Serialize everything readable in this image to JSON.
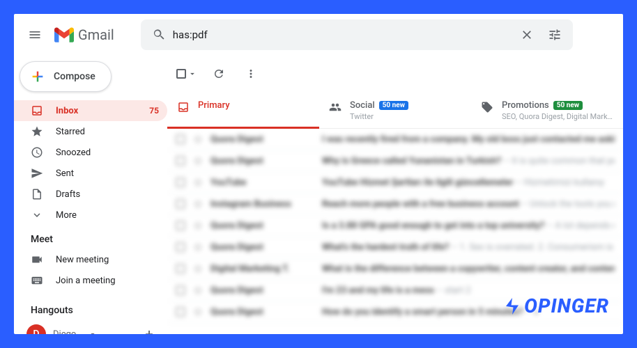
{
  "header": {
    "app_name": "Gmail",
    "search_value": "has:pdf"
  },
  "sidebar": {
    "compose": "Compose",
    "items": [
      {
        "icon": "inbox",
        "label": "Inbox",
        "count": "75",
        "active": true
      },
      {
        "icon": "star",
        "label": "Starred"
      },
      {
        "icon": "clock",
        "label": "Snoozed"
      },
      {
        "icon": "send",
        "label": "Sent"
      },
      {
        "icon": "file",
        "label": "Drafts"
      },
      {
        "icon": "more",
        "label": "More"
      }
    ],
    "meet_title": "Meet",
    "meet_items": [
      {
        "icon": "video",
        "label": "New meeting"
      },
      {
        "icon": "keyboard",
        "label": "Join a meeting"
      }
    ],
    "hangouts_title": "Hangouts",
    "hangouts_user_initial": "D",
    "hangouts_user_name": "Diego"
  },
  "tabs": [
    {
      "icon": "inbox",
      "title": "Primary",
      "active": true
    },
    {
      "icon": "people",
      "title": "Social",
      "badge": "50 new",
      "sub": "Twitter"
    },
    {
      "icon": "tag",
      "title": "Promotions",
      "badge": "50 new",
      "badge_class": "green",
      "sub": "SEO, Quora Digest, Digital Mark..."
    }
  ],
  "threads": [
    {
      "sender": "Quora Digest",
      "subject": "I was recently fired from a company. My old boss just contacted me aski",
      "snippet": ""
    },
    {
      "sender": "Quora Digest",
      "subject": "Why is Greece called Yunanistan in Turkish?",
      "snippet": " – It is quite common that peo"
    },
    {
      "sender": "YouTube",
      "subject": "YouTube Hizmet Şartları ile ilgili güncellemeler",
      "snippet": " – Hizmetimizi kullanıy"
    },
    {
      "sender": "Instagram Business",
      "subject": "Reach more people with a free business account",
      "snippet": " – Unlock the tools you ne"
    },
    {
      "sender": "Quora Digest",
      "subject": "Is a 3.88 GPA good enough to get into a top university?",
      "snippet": " – A lot depends on"
    },
    {
      "sender": "Quora Digest",
      "subject": "What's the hardest truth of life?",
      "snippet": " – 1. Sex is overrated. 2. Consumerism is o"
    },
    {
      "sender": "Digital Marketing T.",
      "subject": "What is the difference between a copywriter, content creator, and conten",
      "snippet": ""
    },
    {
      "sender": "Quora Digest",
      "subject": "I'm 23 and my life is a mess",
      "snippet": " – start 2"
    },
    {
      "sender": "Quora Digest",
      "subject": "How do you identify a smart person in 5 minutes?",
      "snippet": " – a"
    }
  ],
  "watermark": "OPINGER"
}
